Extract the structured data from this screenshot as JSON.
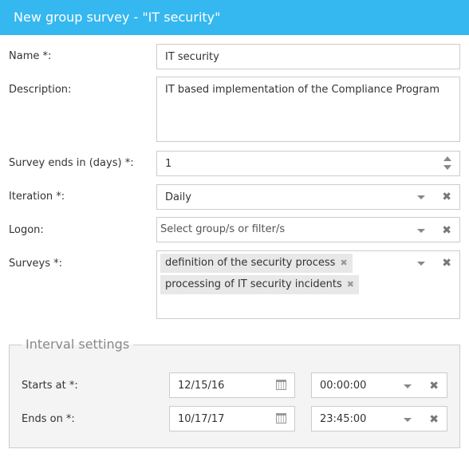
{
  "dialog": {
    "title": "New group survey - \"IT security\""
  },
  "form": {
    "name": {
      "label": "Name *:",
      "value": "IT security"
    },
    "description": {
      "label": "Description:",
      "value": "IT based implementation of the Compliance Program"
    },
    "survey_ends": {
      "label": "Survey ends in (days) *:",
      "value": "1"
    },
    "iteration": {
      "label": "Iteration *:",
      "value": "Daily"
    },
    "logon": {
      "label": "Logon:",
      "placeholder": "Select group/s or filter/s"
    },
    "surveys": {
      "label": "Surveys *:",
      "tags": [
        "definition of the security process",
        "processing of IT security incidents"
      ]
    }
  },
  "interval": {
    "legend": "Interval settings",
    "starts": {
      "label": "Starts at *:",
      "date": "12/15/16",
      "time": "00:00:00"
    },
    "ends": {
      "label": "Ends on *:",
      "date": "10/17/17",
      "time": "23:45:00"
    }
  },
  "icons": {
    "remove": "✖",
    "tag_remove": "✖"
  }
}
